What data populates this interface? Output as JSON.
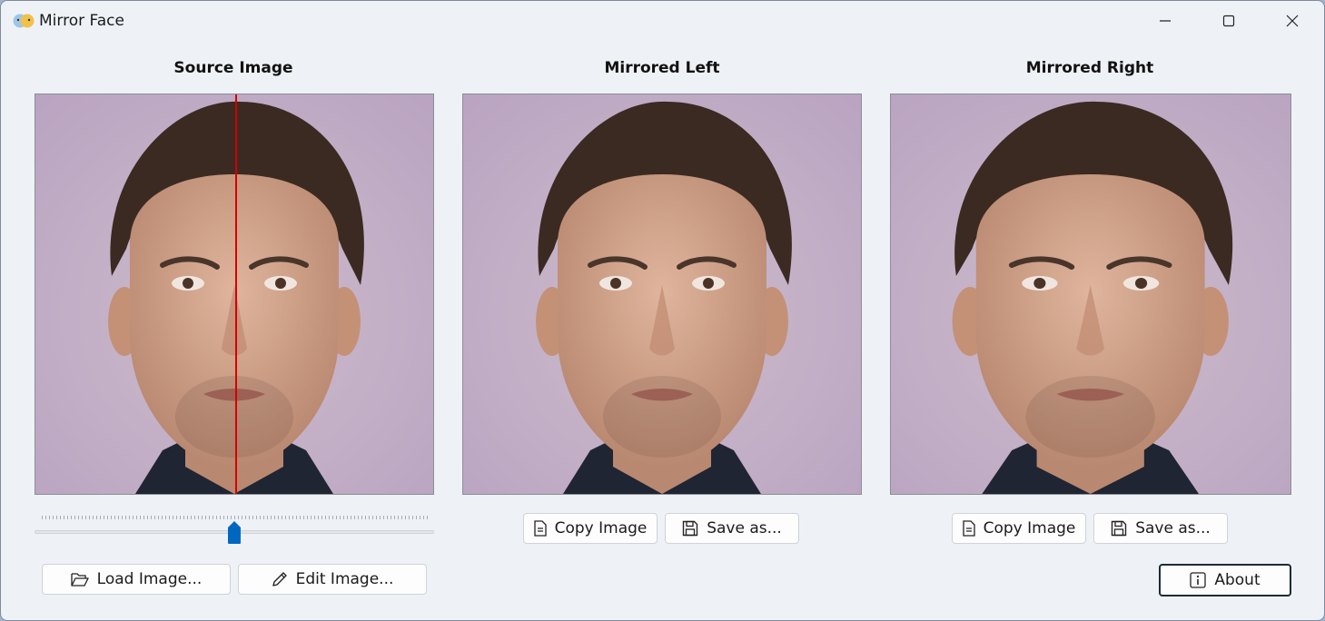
{
  "window": {
    "title": "Mirror Face"
  },
  "columns": {
    "source": {
      "title": "Source Image"
    },
    "left": {
      "title": "Mirrored Left"
    },
    "right": {
      "title": "Mirrored Right"
    }
  },
  "source_controls": {
    "load_label": "Load Image...",
    "edit_label": "Edit Image...",
    "slider_value_fraction": 0.5
  },
  "left_controls": {
    "copy_label": "Copy Image",
    "save_label": "Save as..."
  },
  "right_controls": {
    "copy_label": "Copy Image",
    "save_label": "Save as..."
  },
  "about_label": "About",
  "colors": {
    "accent": "#0067c0",
    "midline": "#d40000"
  },
  "icons": [
    "mirror-face-app-icon",
    "minimize-icon",
    "maximize-icon",
    "close-icon",
    "document-icon",
    "floppy-disk-icon",
    "folder-open-icon",
    "pencil-icon",
    "info-icon"
  ]
}
